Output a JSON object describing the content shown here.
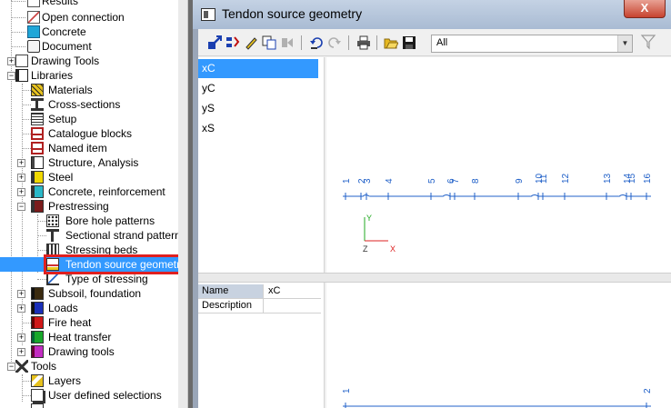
{
  "tree": {
    "items": [
      {
        "label": "Results",
        "icon": "results-icon"
      },
      {
        "label": "Open connection",
        "icon": "open-connection-icon"
      },
      {
        "label": "Concrete",
        "icon": "concrete-icon"
      },
      {
        "label": "Document",
        "icon": "document-icon"
      },
      {
        "label": "Drawing Tools",
        "icon": "drawing-tools-icon"
      },
      {
        "label": "Libraries",
        "icon": "libraries-icon"
      },
      {
        "label": "Materials",
        "icon": "materials-icon"
      },
      {
        "label": "Cross-sections",
        "icon": "cross-sections-icon"
      },
      {
        "label": "Setup",
        "icon": "setup-icon"
      },
      {
        "label": "Catalogue blocks",
        "icon": "catalogue-blocks-icon"
      },
      {
        "label": "Named item",
        "icon": "named-item-icon"
      },
      {
        "label": "Structure, Analysis",
        "icon": "structure-analysis-icon"
      },
      {
        "label": "Steel",
        "icon": "steel-icon"
      },
      {
        "label": "Concrete, reinforcement",
        "icon": "concrete-reinforcement-icon"
      },
      {
        "label": "Prestressing",
        "icon": "prestressing-icon"
      },
      {
        "label": "Bore hole patterns",
        "icon": "bore-hole-patterns-icon"
      },
      {
        "label": "Sectional strand patterns",
        "icon": "sectional-strand-patterns-icon"
      },
      {
        "label": "Stressing beds",
        "icon": "stressing-beds-icon"
      },
      {
        "label": "Tendon source geometry",
        "icon": "tendon-source-geometry-icon"
      },
      {
        "label": "Type of stressing",
        "icon": "type-of-stressing-icon"
      },
      {
        "label": "Subsoil, foundation",
        "icon": "subsoil-foundation-icon"
      },
      {
        "label": "Loads",
        "icon": "loads-icon"
      },
      {
        "label": "Fire heat",
        "icon": "fire-heat-icon"
      },
      {
        "label": "Heat transfer",
        "icon": "heat-transfer-icon"
      },
      {
        "label": "Drawing tools",
        "icon": "drawing-tools-lib-icon"
      },
      {
        "label": "Tools",
        "icon": "tools-icon"
      },
      {
        "label": "Layers",
        "icon": "layers-icon"
      },
      {
        "label": "User defined selections",
        "icon": "user-defined-selections-icon"
      }
    ],
    "selected": "Tendon source geometry"
  },
  "dialog": {
    "title": "Tendon source geometry",
    "close_label": "X",
    "filter_value": "All",
    "toolbar_icons": [
      "new-icon",
      "insert-icon",
      "edit-icon",
      "copy-icon",
      "delete-icon",
      "undo-icon",
      "redo-icon",
      "print-icon",
      "open-icon",
      "save-icon"
    ],
    "filter_icon": "funnel-icon",
    "geometries": [
      "xC",
      "yC",
      "yS",
      "xS"
    ],
    "selected_geometry": "xC",
    "properties": [
      {
        "name": "Name",
        "value": "xC"
      },
      {
        "name": "Description",
        "value": ""
      }
    ]
  },
  "preview_top": {
    "point_labels": [
      "1",
      "2",
      "3",
      "4",
      "5",
      "6",
      "7",
      "8",
      "9",
      "10",
      "11",
      "12",
      "13",
      "14",
      "15",
      "16"
    ],
    "axes": {
      "y": "Y",
      "z": "Z",
      "x": "X"
    }
  },
  "preview_bottom": {
    "point_labels": [
      "1",
      "2"
    ]
  },
  "colors": {
    "selection": "#3399ff",
    "highlight_box": "#e0201f",
    "tendon_line": "#2060c8",
    "axis_y": "#22aa22",
    "axis_x": "#dd2222"
  }
}
